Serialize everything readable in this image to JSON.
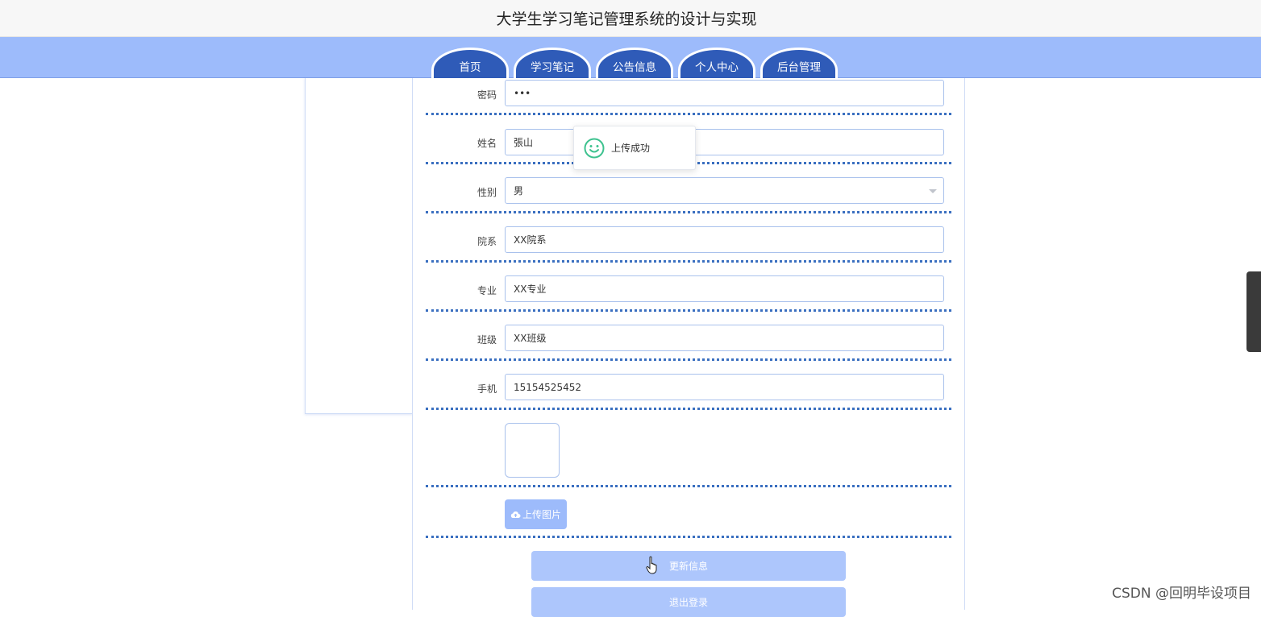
{
  "header": {
    "title": "大学生学习笔记管理系统的设计与实现"
  },
  "nav": {
    "tabs": [
      {
        "label": "首页"
      },
      {
        "label": "学习笔记"
      },
      {
        "label": "公告信息"
      },
      {
        "label": "个人中心"
      },
      {
        "label": "后台管理"
      }
    ]
  },
  "form": {
    "password": {
      "label": "密码",
      "value": "•••"
    },
    "name": {
      "label": "姓名",
      "value": "張山"
    },
    "gender": {
      "label": "性别",
      "value": "男"
    },
    "department": {
      "label": "院系",
      "value": "XX院系"
    },
    "major": {
      "label": "专业",
      "value": "XX专业"
    },
    "class": {
      "label": "班级",
      "value": "XX班级"
    },
    "phone": {
      "label": "手机",
      "value": "15154525452"
    },
    "upload_button": "上传图片",
    "update_button": "更新信息",
    "logout_button": "退出登录"
  },
  "toast": {
    "message": "上传成功",
    "icon": "smile-icon",
    "color": "#3ec28f"
  },
  "watermark": "CSDN @回明毕设项目",
  "colors": {
    "nav_bg": "#9dbbfb",
    "tab_bg": "#2f5bb8",
    "divider": "#3a6fc0",
    "button": "#adc6fc"
  }
}
